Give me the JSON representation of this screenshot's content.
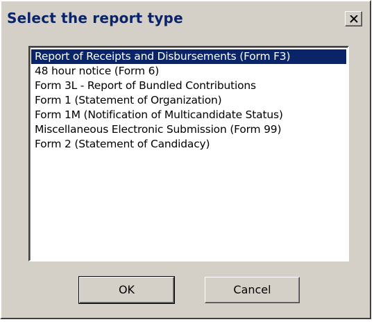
{
  "dialog": {
    "title": "Select the report type",
    "close_label": "×"
  },
  "report_list": {
    "items": [
      {
        "label": "Report of Receipts and Disbursements (Form F3)",
        "selected": true
      },
      {
        "label": "48 hour notice (Form 6)",
        "selected": false
      },
      {
        "label": "Form 3L - Report of Bundled Contributions",
        "selected": false
      },
      {
        "label": "Form 1 (Statement of Organization)",
        "selected": false
      },
      {
        "label": "Form 1M (Notification of Multicandidate Status)",
        "selected": false
      },
      {
        "label": "Miscellaneous Electronic Submission (Form 99)",
        "selected": false
      },
      {
        "label": "Form 2 (Statement of Candidacy)",
        "selected": false
      }
    ]
  },
  "buttons": {
    "ok_label": "OK",
    "cancel_label": "Cancel"
  },
  "colors": {
    "selection": "#0a246a",
    "face": "#d4d0c8",
    "title_text": "#0a246a"
  },
  "icons": {
    "close": "close-icon"
  }
}
